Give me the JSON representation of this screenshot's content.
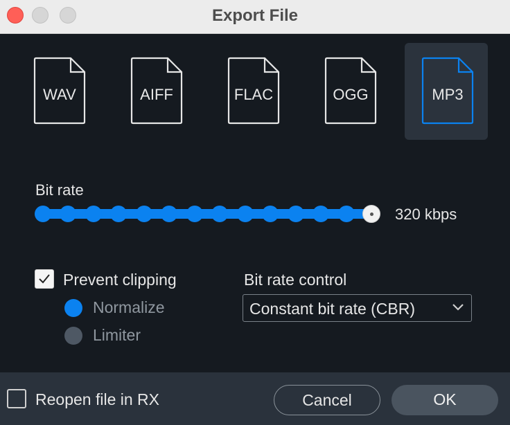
{
  "window": {
    "title": "Export File"
  },
  "formats": [
    {
      "label": "WAV",
      "selected": false
    },
    {
      "label": "AIFF",
      "selected": false
    },
    {
      "label": "FLAC",
      "selected": false
    },
    {
      "label": "OGG",
      "selected": false
    },
    {
      "label": "MP3",
      "selected": true
    }
  ],
  "bitrate": {
    "label": "Bit rate",
    "value_text": "320 kbps",
    "stops": 14,
    "selected_index": 13
  },
  "prevent_clipping": {
    "label": "Prevent clipping",
    "checked": true,
    "options": [
      {
        "label": "Normalize",
        "selected": true
      },
      {
        "label": "Limiter",
        "selected": false
      }
    ]
  },
  "bitrate_control": {
    "label": "Bit rate control",
    "value": "Constant bit rate (CBR)"
  },
  "footer": {
    "reopen_label": "Reopen file in RX",
    "reopen_checked": false,
    "cancel_label": "Cancel",
    "ok_label": "OK"
  },
  "colors": {
    "accent": "#0b82f0",
    "background": "#151a20",
    "footer": "#2a323c"
  }
}
